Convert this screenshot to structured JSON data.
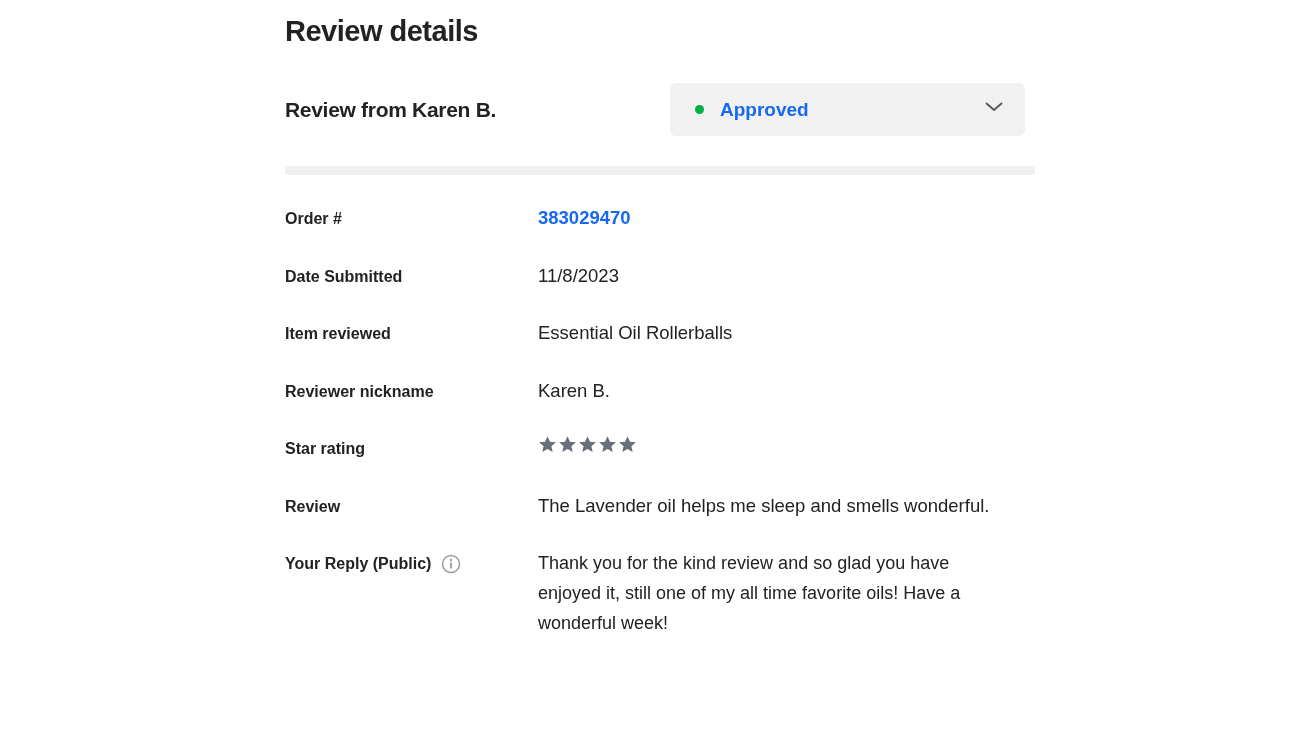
{
  "title": "Review details",
  "review_heading": "Review from Karen B.",
  "status": {
    "label": "Approved",
    "color": "#00b140"
  },
  "details": [
    {
      "kind": "link",
      "label": "Order #",
      "value": "383029470"
    },
    {
      "kind": "text",
      "label": "Date Submitted",
      "value": "11/8/2023"
    },
    {
      "kind": "text",
      "label": "Item reviewed",
      "value": "Essential Oil Rollerballs"
    },
    {
      "kind": "text",
      "label": "Reviewer nickname",
      "value": "Karen B."
    },
    {
      "kind": "stars",
      "label": "Star rating",
      "stars": 5
    },
    {
      "kind": "text",
      "label": "Review",
      "value": "The Lavender oil helps me sleep and smells wonderful."
    },
    {
      "kind": "reply",
      "label": "Your Reply (Public)",
      "value": "Thank you for the kind review and so glad you have enjoyed it, still one of my all time favorite oils! Have a wonderful week!"
    }
  ]
}
